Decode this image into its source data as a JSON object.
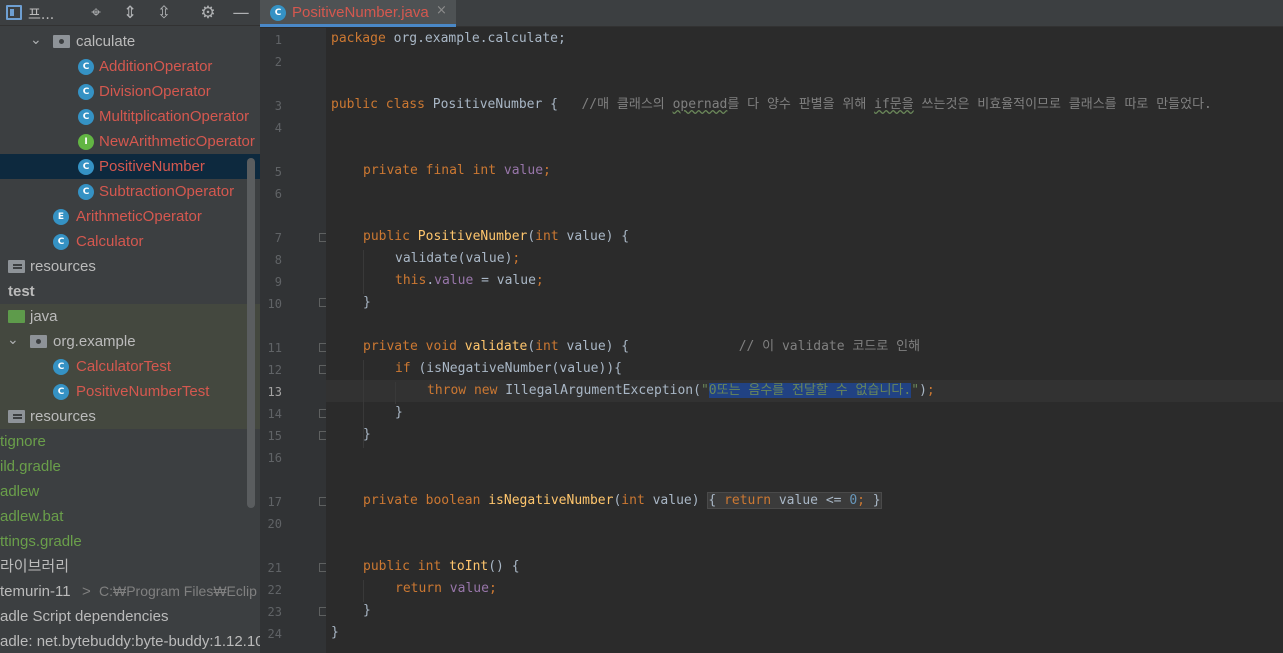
{
  "sidebar": {
    "title": "프...",
    "tree": [
      {
        "label": "calculate",
        "kind": "package"
      },
      {
        "label": "AdditionOperator",
        "kind": "class"
      },
      {
        "label": "DivisionOperator",
        "kind": "class"
      },
      {
        "label": "MultitplicationOperator",
        "kind": "class"
      },
      {
        "label": "NewArithmeticOperator",
        "kind": "interface"
      },
      {
        "label": "PositiveNumber",
        "kind": "class"
      },
      {
        "label": "SubtractionOperator",
        "kind": "class"
      },
      {
        "label": "ArithmeticOperator",
        "kind": "enum"
      },
      {
        "label": "Calculator",
        "kind": "class"
      },
      {
        "label": "resources",
        "kind": "resources"
      },
      {
        "label": "test",
        "kind": "source-set"
      },
      {
        "label": "java",
        "kind": "test-root"
      },
      {
        "label": "org.example",
        "kind": "package"
      },
      {
        "label": "CalculatorTest",
        "kind": "test-class"
      },
      {
        "label": "PositiveNumberTest",
        "kind": "test-class"
      },
      {
        "label": "resources",
        "kind": "resources"
      },
      {
        "label": "tignore",
        "kind": "file"
      },
      {
        "label": "ild.gradle",
        "kind": "file"
      },
      {
        "label": "adlew",
        "kind": "file"
      },
      {
        "label": "adlew.bat",
        "kind": "file"
      },
      {
        "label": "ttings.gradle",
        "kind": "file"
      },
      {
        "label": "라이브러리",
        "kind": "libraries"
      },
      {
        "label": "temurin-11",
        "extra": "C:₩Program Files₩Eclip",
        "kind": "sdk"
      },
      {
        "label": "adle Script dependencies",
        "kind": "deps"
      },
      {
        "label": "adle: net.bytebuddy:byte-buddy:1.12.10",
        "kind": "library"
      }
    ]
  },
  "editor": {
    "tab": {
      "label": "PositiveNumber.java",
      "close": "×"
    },
    "line_numbers": [
      "1",
      "2",
      "3",
      "4",
      "5",
      "6",
      "7",
      "8",
      "9",
      "10",
      "11",
      "12",
      "13",
      "14",
      "15",
      "16",
      "17",
      "20",
      "21",
      "22",
      "23",
      "24"
    ],
    "current_line": "13",
    "code": {
      "l1_pkg": "package",
      "l1_rest": " org.example.calculate;",
      "l3_kw": "public class ",
      "l3_name": "PositiveNumber {   ",
      "l3_c1": "//매 클래스의 ",
      "l3_c2": "opernad",
      "l3_c3": "를 다 양수 판별을 위해 ",
      "l3_c4": "if문을",
      "l3_c5": " 쓰는것은 비효율적이므로 클래스를 따로 만들었다.",
      "l5_kw": "private final int ",
      "l5_fld": "value",
      "l5_end": ";",
      "l7_kw": "public ",
      "l7_fn": "PositiveNumber",
      "l7_p1": "(",
      "l7_kw2": "int ",
      "l7_p2": "value) {",
      "l8_a": "validate(value)",
      "l8_b": ";",
      "l9_kw": "this",
      "l9_dot": ".",
      "l9_fld": "value",
      "l9_rest": " = value",
      "l9_end": ";",
      "l10": "}",
      "l11_kw": "private void ",
      "l11_fn": "validate",
      "l11_p1": "(",
      "l11_kw2": "int ",
      "l11_p2": "value) {              ",
      "l11_cmt": "// 이 validate 코드로 인해",
      "l12_kw": "if ",
      "l12_rest": "(isNegativeNumber(value)){",
      "l13_kw": "throw new ",
      "l13_a": "IllegalArgumentException(",
      "l13_q1": "\"",
      "l13_sel": "0또는 음수를 전달할 수 없습니다.",
      "l13_q2": "\"",
      "l13_b": ")",
      "l13_end": ";",
      "l14": "}",
      "l15": "}",
      "l17_kw": "private boolean ",
      "l17_fn": "isNegativeNumber",
      "l17_p1": "(",
      "l17_kw2": "int ",
      "l17_p2": "value) ",
      "l17_b1": "{ ",
      "l17_kw3": "return ",
      "l17_a": "value <= ",
      "l17_num": "0",
      "l17_semi": ";",
      "l17_b2": " }",
      "l21_kw": "public int ",
      "l21_fn": "toInt",
      "l21_rest": "() {",
      "l22_kw": "return ",
      "l22_fld": "value",
      "l22_end": ";",
      "l23": "}",
      "l24": "}"
    }
  }
}
